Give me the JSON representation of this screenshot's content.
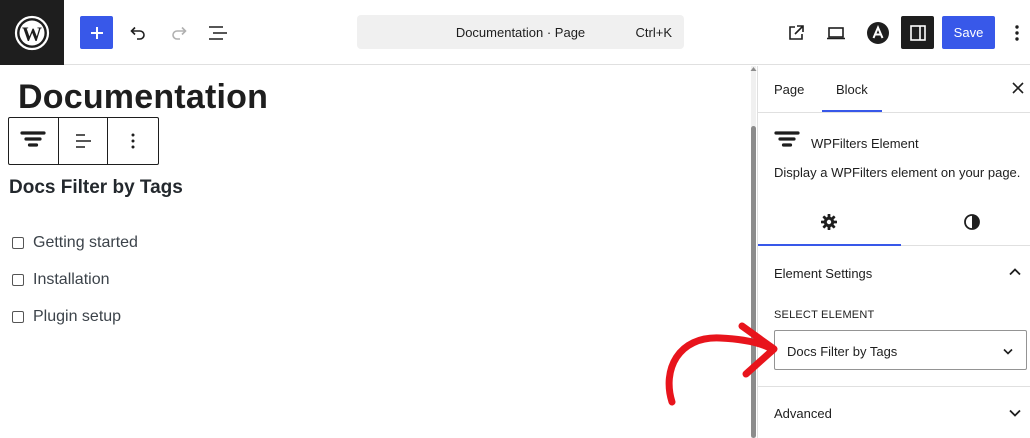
{
  "colors": {
    "accent": "#3858e9",
    "dark": "#1e1e1e",
    "annotation": "#e8141c"
  },
  "topbar": {
    "document_title": "Documentation · Page",
    "shortcut": "Ctrl+K",
    "save_label": "Save",
    "icons": [
      "wordpress-logo-icon",
      "plus-icon",
      "undo-icon",
      "redo-icon",
      "list-view-icon",
      "external-link-icon",
      "device-preview-icon",
      "astra-icon",
      "sidebar-toggle-icon",
      "more-options-icon"
    ]
  },
  "canvas": {
    "page_title": "Documentation",
    "block_toolbar": {
      "icons": [
        "wpfilters-block-icon",
        "align-left-icon",
        "more-vertical-icon"
      ]
    },
    "filter_heading": "Docs Filter by Tags",
    "filter_items": [
      {
        "label": "Getting started",
        "checked": false
      },
      {
        "label": "Installation",
        "checked": false
      },
      {
        "label": "Plugin setup",
        "checked": false
      }
    ]
  },
  "sidebar": {
    "tabs": [
      {
        "label": "Page",
        "active": false
      },
      {
        "label": "Block",
        "active": true
      }
    ],
    "block": {
      "name": "WPFilters Element",
      "description": "Display a WPFilters element on your page."
    },
    "sub_tabs": [
      {
        "icon": "gear-icon",
        "active": true
      },
      {
        "icon": "styles-contrast-icon",
        "active": false
      }
    ],
    "panels": {
      "element_settings": {
        "title": "Element Settings",
        "expanded": true,
        "select_label": "Select Element",
        "select_value": "Docs Filter by Tags"
      },
      "advanced": {
        "title": "Advanced",
        "expanded": false
      }
    }
  }
}
